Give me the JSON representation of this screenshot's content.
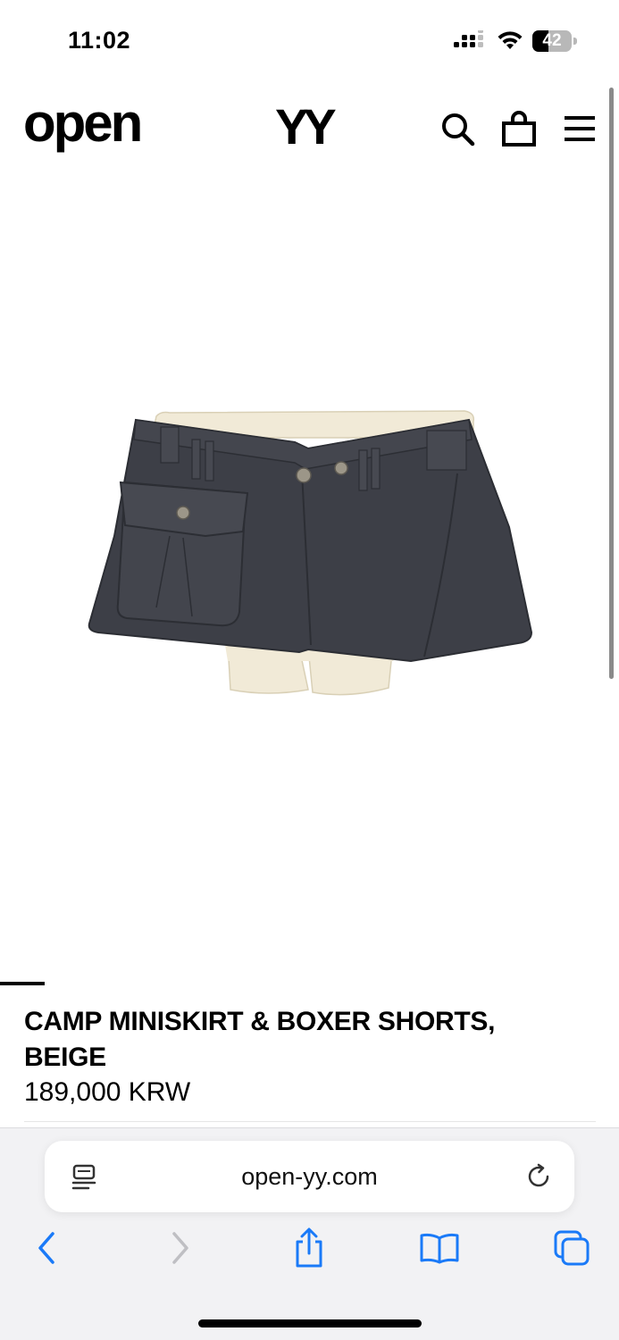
{
  "status_bar": {
    "time": "11:02",
    "battery_level": "42",
    "battery_fraction": 0.42,
    "icons": [
      "signal-icon",
      "wifi-icon",
      "battery-icon"
    ]
  },
  "header": {
    "logo_left": "OPEN",
    "logo_right": "YY",
    "icons": [
      "search-icon",
      "shopping-bag-icon",
      "menu-icon"
    ]
  },
  "product": {
    "image_alt": "camp-miniskirt-boxer-shorts-image",
    "title": "CAMP MINISKIRT & BOXER SHORTS, BEIGE",
    "price": "189,000 KRW",
    "colors": {
      "skirt": "#3d3f47",
      "shorts": "#f1ead7"
    }
  },
  "browser": {
    "url": "open-yy.com",
    "icons": [
      "reader-icon",
      "reload-icon",
      "back-icon",
      "forward-icon",
      "share-icon",
      "bookmarks-icon",
      "tabs-icon"
    ],
    "accent": "#1a7af8"
  }
}
